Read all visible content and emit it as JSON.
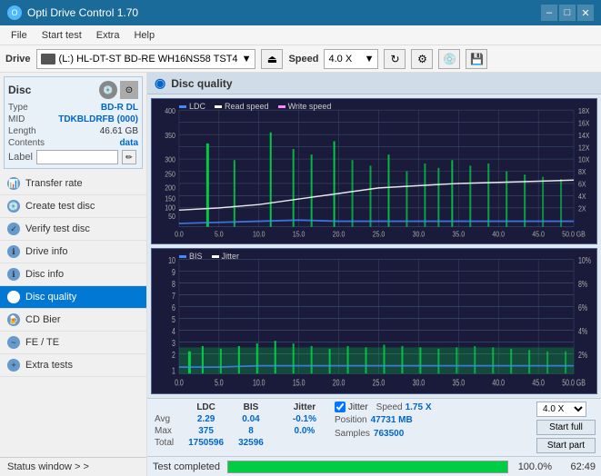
{
  "titlebar": {
    "title": "Opti Drive Control 1.70",
    "minimize": "–",
    "maximize": "□",
    "close": "✕"
  },
  "menubar": {
    "items": [
      "File",
      "Start test",
      "Extra",
      "Help"
    ]
  },
  "toolbar": {
    "drive_label": "Drive",
    "drive_value": "(L:)  HL-DT-ST BD-RE  WH16NS58 TST4",
    "speed_label": "Speed",
    "speed_value": "4.0 X"
  },
  "disc": {
    "title": "Disc",
    "type_label": "Type",
    "type_value": "BD-R DL",
    "mid_label": "MID",
    "mid_value": "TDKBLDRFB (000)",
    "length_label": "Length",
    "length_value": "46.61 GB",
    "contents_label": "Contents",
    "contents_value": "data",
    "label_label": "Label"
  },
  "nav": {
    "items": [
      {
        "id": "transfer-rate",
        "label": "Transfer rate",
        "active": false
      },
      {
        "id": "create-test-disc",
        "label": "Create test disc",
        "active": false
      },
      {
        "id": "verify-test-disc",
        "label": "Verify test disc",
        "active": false
      },
      {
        "id": "drive-info",
        "label": "Drive info",
        "active": false
      },
      {
        "id": "disc-info",
        "label": "Disc info",
        "active": false
      },
      {
        "id": "disc-quality",
        "label": "Disc quality",
        "active": true
      },
      {
        "id": "cd-bier",
        "label": "CD Bier",
        "active": false
      },
      {
        "id": "fe-te",
        "label": "FE / TE",
        "active": false
      },
      {
        "id": "extra-tests",
        "label": "Extra tests",
        "active": false
      }
    ]
  },
  "status_window": {
    "label": "Status window > >"
  },
  "disc_quality": {
    "title": "Disc quality",
    "chart1": {
      "legend": [
        {
          "label": "LDC",
          "color": "#4488ff"
        },
        {
          "label": "Read speed",
          "color": "#ffffff"
        },
        {
          "label": "Write speed",
          "color": "#ff88ff"
        }
      ],
      "y_max": 400,
      "y_labels": [
        "400",
        "350",
        "300",
        "250",
        "200",
        "150",
        "100",
        "50",
        "0"
      ],
      "y_right_labels": [
        "18X",
        "16X",
        "14X",
        "12X",
        "10X",
        "8X",
        "6X",
        "4X",
        "2X"
      ],
      "x_labels": [
        "0.0",
        "5.0",
        "10.0",
        "15.0",
        "20.0",
        "25.0",
        "30.0",
        "35.0",
        "40.0",
        "45.0",
        "50.0 GB"
      ]
    },
    "chart2": {
      "legend": [
        {
          "label": "BIS",
          "color": "#4488ff"
        },
        {
          "label": "Jitter",
          "color": "#ffffff"
        }
      ],
      "y_max": 10,
      "y_labels": [
        "10",
        "9",
        "8",
        "7",
        "6",
        "5",
        "4",
        "3",
        "2",
        "1"
      ],
      "y_right_labels": [
        "10%",
        "8%",
        "6%",
        "4%",
        "2%"
      ],
      "x_labels": [
        "0.0",
        "5.0",
        "10.0",
        "15.0",
        "20.0",
        "25.0",
        "30.0",
        "35.0",
        "40.0",
        "45.0",
        "50.0 GB"
      ]
    }
  },
  "stats": {
    "col_ldc": "LDC",
    "col_bis": "BIS",
    "col_jitter": "Jitter",
    "row_avg": "Avg",
    "row_max": "Max",
    "row_total": "Total",
    "avg_ldc": "2.29",
    "avg_bis": "0.04",
    "avg_jitter": "-0.1%",
    "max_ldc": "375",
    "max_bis": "8",
    "max_jitter": "0.0%",
    "total_ldc": "1750596",
    "total_bis": "32596",
    "jitter_checked": true,
    "jitter_label": "Jitter",
    "speed_label": "Speed",
    "speed_value": "1.75 X",
    "position_label": "Position",
    "position_value": "47731 MB",
    "samples_label": "Samples",
    "samples_value": "763500",
    "speed_select": "4.0 X",
    "btn_start_full": "Start full",
    "btn_start_part": "Start part"
  },
  "progress": {
    "percent": 100.0,
    "percent_label": "100.0%",
    "time_label": "62:49",
    "status_text": "Test completed"
  }
}
